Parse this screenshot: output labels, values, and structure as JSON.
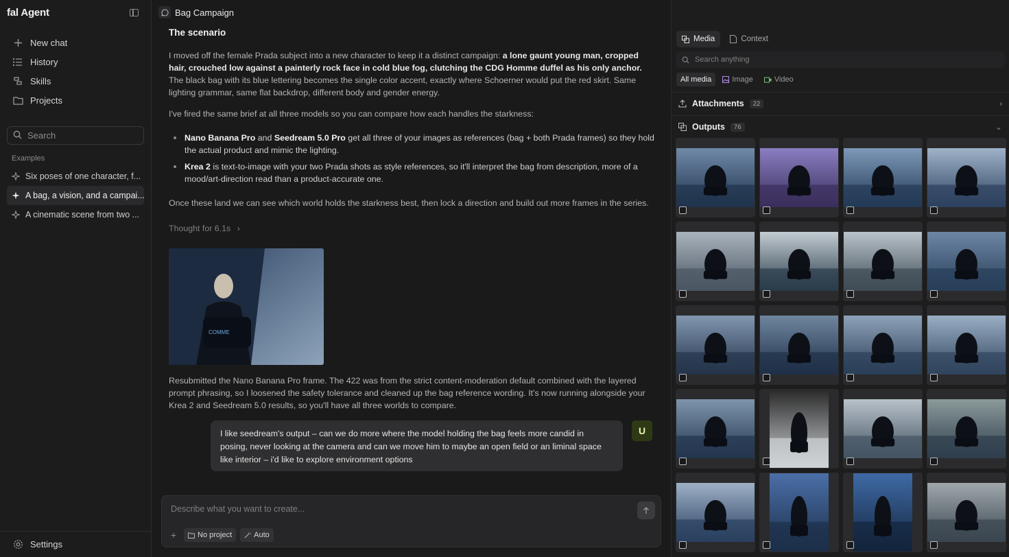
{
  "sidebar": {
    "brand": "fal Agent",
    "nav": [
      {
        "label": "New chat",
        "icon": "plus-icon"
      },
      {
        "label": "History",
        "icon": "history-icon"
      },
      {
        "label": "Skills",
        "icon": "skills-icon"
      },
      {
        "label": "Projects",
        "icon": "folder-icon"
      }
    ],
    "search_placeholder": "Search",
    "section_label": "Examples",
    "examples": [
      {
        "label": "Six poses of one character, f...",
        "active": false
      },
      {
        "label": "A bag, a vision, and a campai...",
        "active": true
      },
      {
        "label": "A cinematic scene from two ...",
        "active": false
      }
    ],
    "settings_label": "Settings"
  },
  "topbar": {
    "title": "Bag Campaign"
  },
  "chat": {
    "heading": "The scenario",
    "p1_a": "I moved off the female Prada subject into a new character to keep it a distinct campaign: ",
    "p1_b": "a lone gaunt young man, cropped hair, crouched low against a painterly rock face in cold blue fog, clutching the CDG Homme duffel as his only anchor.",
    "p1_c": " The black bag with its blue lettering becomes the single color accent, exactly where Schoerner would put the red skirt. Same lighting grammar, same flat backdrop, different body and gender energy.",
    "p2": "I've fired the same brief at all three models so you can compare how each handles the starkness:",
    "b1_a": "Nano Banana Pro",
    "b1_b": " and ",
    "b1_c": "Seedream 5.0 Pro",
    "b1_d": " get all three of your images as references (bag + both Prada frames) so they hold the actual product and mimic the lighting.",
    "b2_a": "Krea 2",
    "b2_b": " is text-to-image with your two Prada shots as style references, so it'll interpret the bag from description, more of a mood/art-direction read than a product-accurate one.",
    "p3": "Once these land we can see which world holds the starkness best, then lock a direction and build out more frames in the series.",
    "thought": "Thought for 6.1s",
    "p4": "Resubmitted the Nano Banana Pro frame. The 422 was from the strict content-moderation default combined with the layered prompt phrasing, so I loosened the safety tolerance and cleaned up the bag reference wording. It's now running alongside your Krea 2 and Seedream 5.0 results, so you'll have all three worlds to compare.",
    "user_msg": "I like seedream's output – can we do more where the model holding the bag feels more candid in posing, never looking at the camera and can we move him to maybe an open field or an liminal space like interior – i'd like to explore environment options",
    "user_initial": "U"
  },
  "composer": {
    "placeholder": "Describe what you want to create...",
    "project_chip": "No project",
    "mode_chip": "Auto"
  },
  "panel": {
    "tabs": [
      {
        "label": "Media",
        "active": true
      },
      {
        "label": "Context",
        "active": false
      }
    ],
    "search_placeholder": "Search anything",
    "filters": [
      {
        "label": "All media",
        "active": true
      },
      {
        "label": "Image",
        "active": false
      },
      {
        "label": "Video",
        "active": false
      }
    ],
    "attachments": {
      "label": "Attachments",
      "count": "22"
    },
    "outputs": {
      "label": "Outputs",
      "count": "76"
    }
  },
  "colors": {
    "accent_avatar_bg": "#2e3a14",
    "background": "#1a1a1b",
    "panel": "#1d1d1e"
  }
}
